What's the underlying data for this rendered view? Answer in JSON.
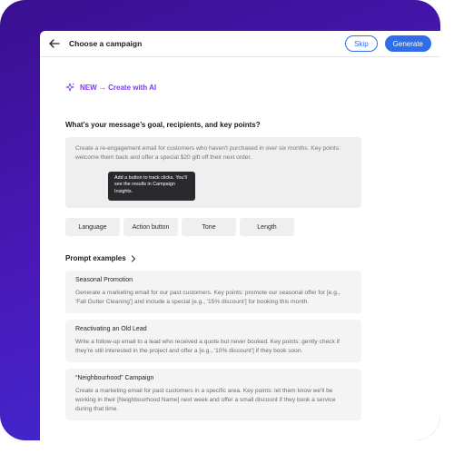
{
  "header": {
    "title": "Choose a campaign",
    "skip_label": "Skip",
    "generate_label": "Generate"
  },
  "ai_link": {
    "label": "NEW → Create with AI"
  },
  "question": "What’s your message’s goal, recipients, and key points?",
  "textarea": {
    "placeholder": "Create a re-engagement email for customers who haven't purchased in over six months. Key points: welcome them back and offer a special $20 gift off their next order."
  },
  "tooltip": {
    "text": "Add a button to track clicks. You'll see the results in Campaign Insights."
  },
  "chips": [
    "Language",
    "Action button",
    "Tone",
    "Length"
  ],
  "prompt_examples": {
    "heading": "Prompt examples",
    "items": [
      {
        "title": "Seasonal Promotion",
        "body": "Generate a marketing email for our past customers. Key points: promote our seasonal offer for [e.g., 'Fall Gutter Cleaning'] and include a special [e.g., '15% discount'] for booking this month."
      },
      {
        "title": "Reactivating an Old Lead",
        "body": "Write a follow-up email to a lead who received a quote but never booked. Key points: gently check if they're still interested in the project and offer a [e.g., '10% discount'] if they book soon."
      },
      {
        "title": "“Neighbourhood” Campaign",
        "body": "Create a marketing email for past customers in a specific area. Key points: let them know we'll be working in their [Neighbourhood Name] next week and offer a small discount if they book a service during that time."
      }
    ]
  },
  "colors": {
    "frame_gradient_start": "#3a0f8f",
    "frame_gradient_end": "#3b2fd9",
    "primary": "#2f6ee8",
    "ai_accent": "#7c3aed"
  }
}
